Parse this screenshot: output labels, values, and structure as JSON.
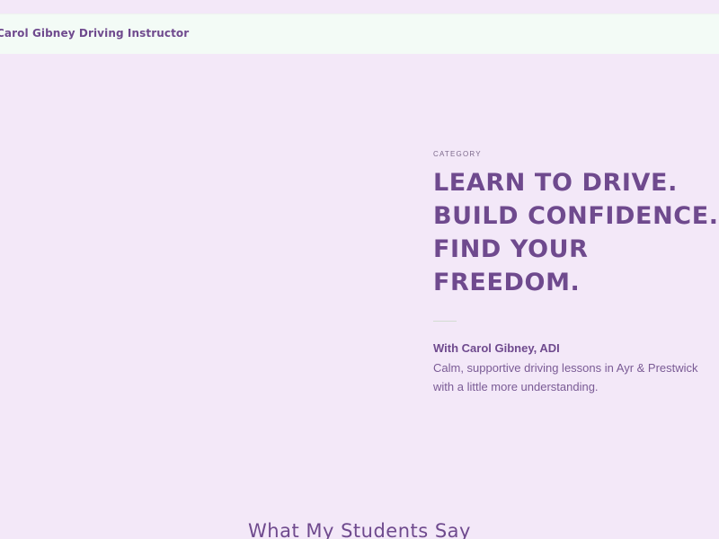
{
  "header": {
    "site_title": "Carol Gibney Driving Instructor"
  },
  "hero": {
    "category": "CATEGORY",
    "headline_lines": [
      "LEARN TO DRIVE.",
      "BUILD CONFIDENCE.",
      "FIND YOUR",
      "FREEDOM."
    ],
    "byline": "With Carol Gibney, ADI",
    "description": "Calm, supportive driving lessons in Ayr & Prestwick with a little more understanding."
  },
  "testimonials": {
    "heading": "What My Students Say"
  },
  "colors": {
    "background": "#f3e8f8",
    "header_background": "#f3fbf6",
    "accent": "#6f4a8e"
  }
}
